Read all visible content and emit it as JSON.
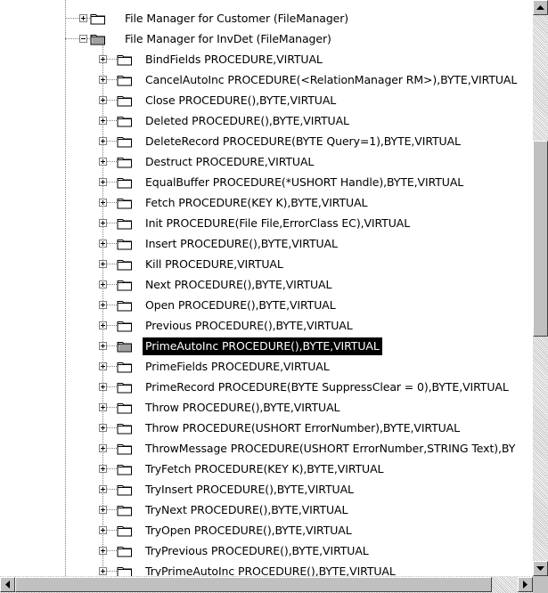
{
  "tree": {
    "parents": [
      {
        "label": "File Manager for Customer (FileManager)",
        "expanded": false,
        "icon": "folder-icon"
      },
      {
        "label": "File Manager for InvDet (FileManager)",
        "expanded": true,
        "icon": "folder-open-icon"
      }
    ],
    "children": [
      {
        "label": "BindFields PROCEDURE,VIRTUAL"
      },
      {
        "label": "CancelAutoInc PROCEDURE(<RelationManager RM>),BYTE,VIRTUAL"
      },
      {
        "label": "Close PROCEDURE(),BYTE,VIRTUAL"
      },
      {
        "label": "Deleted PROCEDURE(),BYTE,VIRTUAL"
      },
      {
        "label": "DeleteRecord PROCEDURE(BYTE Query=1),BYTE,VIRTUAL"
      },
      {
        "label": "Destruct PROCEDURE,VIRTUAL"
      },
      {
        "label": "EqualBuffer PROCEDURE(*USHORT Handle),BYTE,VIRTUAL"
      },
      {
        "label": "Fetch PROCEDURE(KEY K),BYTE,VIRTUAL"
      },
      {
        "label": "Init PROCEDURE(File File,ErrorClass EC),VIRTUAL"
      },
      {
        "label": "Insert PROCEDURE(),BYTE,VIRTUAL"
      },
      {
        "label": "Kill PROCEDURE,VIRTUAL"
      },
      {
        "label": "Next PROCEDURE(),BYTE,VIRTUAL"
      },
      {
        "label": "Open PROCEDURE(),BYTE,VIRTUAL"
      },
      {
        "label": "Previous PROCEDURE(),BYTE,VIRTUAL"
      },
      {
        "label": "PrimeAutoInc PROCEDURE(),BYTE,VIRTUAL",
        "selected": true
      },
      {
        "label": "PrimeFields PROCEDURE,VIRTUAL"
      },
      {
        "label": "PrimeRecord PROCEDURE(BYTE SuppressClear = 0),BYTE,VIRTUAL"
      },
      {
        "label": "Throw PROCEDURE(),BYTE,VIRTUAL"
      },
      {
        "label": "Throw PROCEDURE(USHORT ErrorNumber),BYTE,VIRTUAL"
      },
      {
        "label": "ThrowMessage PROCEDURE(USHORT ErrorNumber,STRING Text),BY"
      },
      {
        "label": "TryFetch PROCEDURE(KEY K),BYTE,VIRTUAL"
      },
      {
        "label": "TryInsert PROCEDURE(),BYTE,VIRTUAL"
      },
      {
        "label": "TryNext PROCEDURE(),BYTE,VIRTUAL"
      },
      {
        "label": "TryOpen PROCEDURE(),BYTE,VIRTUAL"
      },
      {
        "label": "TryPrevious PROCEDURE(),BYTE,VIRTUAL"
      },
      {
        "label": "TryPrimeAutoInc PROCEDURE(),BYTE,VIRTUAL"
      }
    ]
  },
  "scrollbars": {
    "vertical": {
      "position_fraction": 0.36
    },
    "horizontal": {
      "position_fraction": 0.0
    }
  },
  "colors": {
    "selection_bg": "#000000",
    "selection_fg": "#ffffff",
    "folder_fill": "#ffffff",
    "folder_line": "#000000",
    "scrollbar_face": "#c0c0c0"
  }
}
